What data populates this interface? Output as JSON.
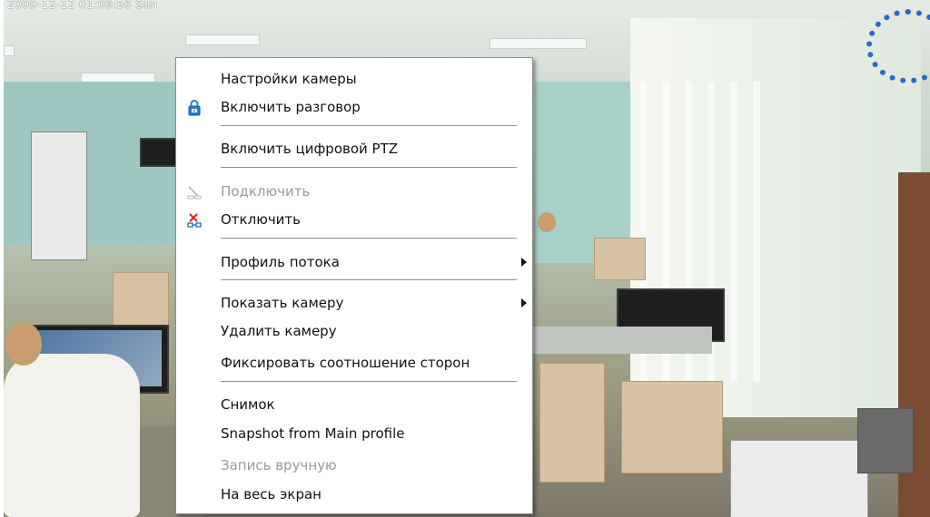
{
  "overlay": {
    "timestamp": "2009-12-12 01:06:56 Sun"
  },
  "menu": {
    "camera_settings": "Настройки камеры",
    "enable_talk": "Включить разговор",
    "enable_digital_ptz": "Включить цифровой PTZ",
    "connect": "Подключить",
    "disconnect": "Отключить",
    "stream_profile": "Профиль потока",
    "show_camera": "Показать камеру",
    "delete_camera": "Удалить камеру",
    "fix_aspect_ratio": "Фиксировать соотношение сторон",
    "snapshot": "Снимок",
    "snapshot_main_profile": "Snapshot from Main profile",
    "manual_record": "Запись вручную",
    "fullscreen": "На весь экран"
  },
  "icons": {
    "enable_talk": "lock-talk-icon",
    "connect": "connect-icon",
    "disconnect": "disconnect-icon",
    "stream_profile_arrow": "submenu-arrow-icon",
    "show_camera_arrow": "submenu-arrow-icon"
  },
  "colors": {
    "menu_bg": "#ffffff",
    "disabled_text": "#9a9a9a",
    "separator": "#8f8f8f"
  }
}
